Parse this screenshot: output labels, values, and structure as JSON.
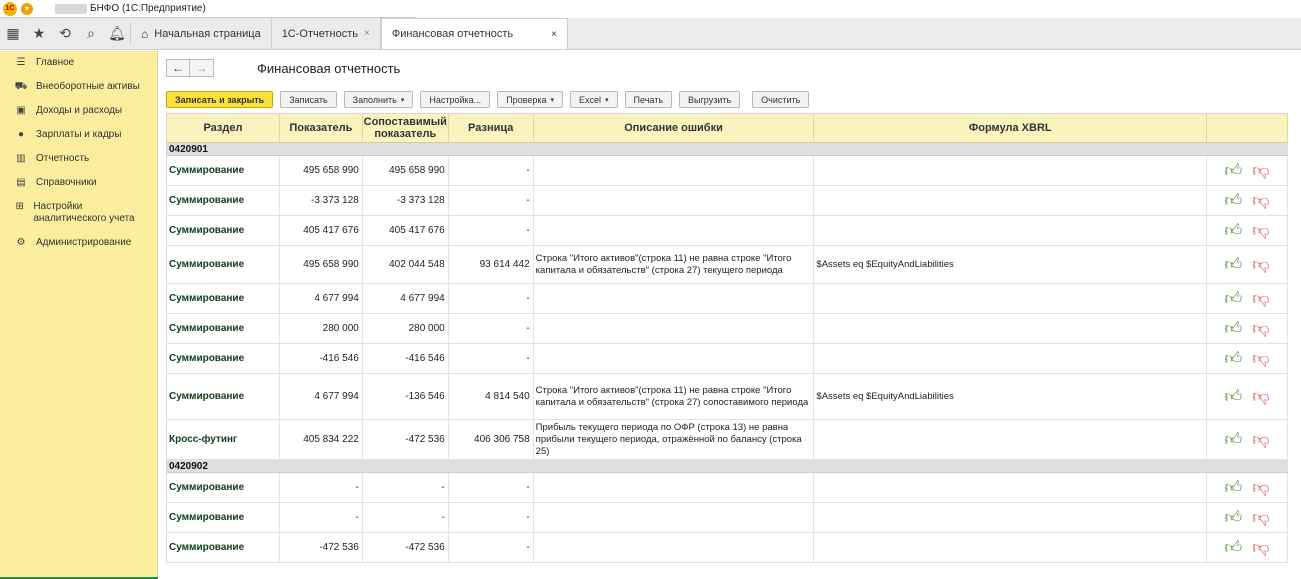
{
  "app": {
    "logo": "1С",
    "title": "БНФО  (1С:Предприятие)"
  },
  "tabs": [
    {
      "label": "Начальная страница"
    },
    {
      "label": "1С-Отчетность"
    },
    {
      "label": "Финансовая отчетность"
    }
  ],
  "sidebar": {
    "items": [
      {
        "label": "Главное",
        "icon": "menu-icon"
      },
      {
        "label": "Внеоборотные активы",
        "icon": "truck-icon"
      },
      {
        "label": "Доходы и расходы",
        "icon": "briefcase-icon"
      },
      {
        "label": "Зарплаты и кадры",
        "icon": "person-icon"
      },
      {
        "label": "Отчетность",
        "icon": "chart-icon"
      },
      {
        "label": "Справочники",
        "icon": "books-icon"
      },
      {
        "label": "Настройки аналитического учета",
        "icon": "structure-icon"
      },
      {
        "label": "Администрирование",
        "icon": "gear-icon"
      }
    ]
  },
  "form": {
    "title": "Финансовая отчетность"
  },
  "toolbar": {
    "save_close": "Записать и закрыть",
    "save": "Записать",
    "fill": "Заполнить",
    "settings": "Настройка...",
    "check": "Проверка",
    "excel": "Excel",
    "print": "Печать",
    "export": "Выгрузить",
    "clear": "Очистить"
  },
  "table": {
    "headers": {
      "section": "Раздел",
      "indicator": "Показатель",
      "comparable": "Сопоставимый показатель",
      "diff": "Разница",
      "error": "Описание ошибки",
      "formula": "Формула XBRL"
    },
    "groups": [
      {
        "code": "0420901",
        "rows": [
          {
            "section": "Суммирование",
            "value": "495 658 990",
            "comparable": "495 658 990",
            "diff": "-",
            "error": "",
            "formula": ""
          },
          {
            "section": "Суммирование",
            "value": "-3 373 128",
            "comparable": "-3 373 128",
            "diff": "-",
            "error": "",
            "formula": ""
          },
          {
            "section": "Суммирование",
            "value": "405 417 676",
            "comparable": "405 417 676",
            "diff": "-",
            "error": "",
            "formula": ""
          },
          {
            "section": "Суммирование",
            "value": "495 658 990",
            "comparable": "402 044 548",
            "diff": "93 614 442",
            "error": "Строка \"Итого активов\"(строка 11) не равна строке \"Итого капитала и обязательств\" (строка 27) текущего периода",
            "formula": "$Assets eq $EquityAndLiabilities"
          },
          {
            "section": "Суммирование",
            "value": "4 677 994",
            "comparable": "4 677 994",
            "diff": "-",
            "error": "",
            "formula": ""
          },
          {
            "section": "Суммирование",
            "value": "280 000",
            "comparable": "280 000",
            "diff": "-",
            "error": "",
            "formula": ""
          },
          {
            "section": "Суммирование",
            "value": "-416 546",
            "comparable": "-416 546",
            "diff": "-",
            "error": "",
            "formula": ""
          },
          {
            "section": "Суммирование",
            "value": "4 677 994",
            "comparable": "-136 546",
            "diff": "4 814 540",
            "error": "Строка \"Итого активов\"(строка 11) не равна строке \"Итого капитала и обязательств\" (строка 27) сопоставимого периода",
            "formula": "$Assets eq $EquityAndLiabilities"
          },
          {
            "section": "Кросс-футинг",
            "value": "405 834 222",
            "comparable": "-472 536",
            "diff": "406 306 758",
            "error": "Прибыль текущего периода по ОФР (строка 13) не равна прибыли текущего периода, отражённой по балансу (строка 25)",
            "formula": ""
          }
        ]
      },
      {
        "code": "0420902",
        "rows": [
          {
            "section": "Суммирование",
            "value": "-",
            "comparable": "-",
            "diff": "-",
            "error": "",
            "formula": ""
          },
          {
            "section": "Суммирование",
            "value": "-",
            "comparable": "-",
            "diff": "-",
            "error": "",
            "formula": ""
          },
          {
            "section": "Суммирование",
            "value": "-472 536",
            "comparable": "-472 536",
            "diff": "-",
            "error": "",
            "formula": ""
          }
        ]
      }
    ]
  },
  "colors": {
    "sidebar_bg": "#fbed9e",
    "header_bg": "#fbf3be",
    "primary_button": "#fbe13b",
    "thumb_up": "#4e8f3a",
    "thumb_down": "#d65a5a"
  }
}
